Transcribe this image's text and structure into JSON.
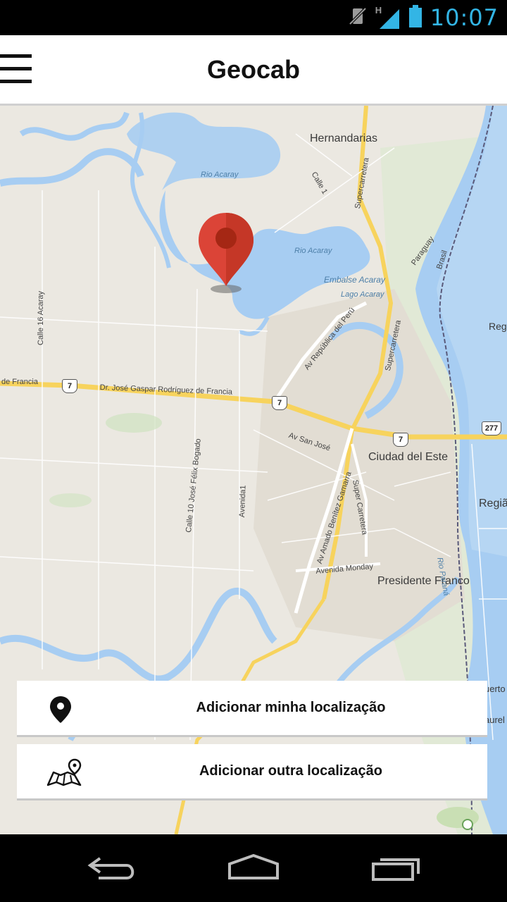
{
  "status_bar": {
    "time": "10:07",
    "network_label": "H",
    "icons": [
      "mute-vibrate-icon",
      "signal-icon",
      "battery-icon"
    ],
    "accent_color": "#33b5e5"
  },
  "app_bar": {
    "title": "Geocab",
    "menu_icon": "hamburger-menu-icon"
  },
  "map": {
    "cities": {
      "hernandarias": "Hernandarias",
      "ciudad_del_este": "Ciudad del Este",
      "presidente_franco": "Presidente Franco",
      "regi": "Regi",
      "regia": "Regiã",
      "puerto": "uerto",
      "iguazu": "aurel"
    },
    "water": {
      "rio_acaray_1": "Rio Acaray",
      "rio_acaray_2": "Rio Acaray",
      "embalse": "Embalse Acaray",
      "lago": "Lago Acaray",
      "rio_parana": "Rio Paraná"
    },
    "roads": {
      "calle_16": "Calle 16 Acaray",
      "calle_1": "Calle 1",
      "supercarretera_1": "Supercarretera",
      "supercarretera_2": "Supercarretera",
      "super_carretera": "Super Carretera",
      "av_republica": "Av República del Perú",
      "francia_left": "de Francia",
      "francia_main": "Dr. José Gaspar Rodríguez de Francia",
      "av_san_jose": "Av San José",
      "calle_10": "Calle 10 José Félix Bogado",
      "avenida_1": "Avenida1",
      "av_amado": "Av Amado Benítez Gamarra",
      "avenida_monday": "Avenida Monday",
      "paraguay": "Paraguay",
      "brasil": "Brasil"
    },
    "route_shields": {
      "r7_a": "7",
      "r7_b": "7",
      "r7_c": "7",
      "r277": "277"
    },
    "marker_color": "#db4437",
    "water_color": "#a7cdf2",
    "highway_color": "#f7d35d"
  },
  "actions": [
    {
      "label": "Adicionar minha localização",
      "icon": "location-pin-icon"
    },
    {
      "label": "Adicionar outra localização",
      "icon": "folded-map-pin-icon"
    }
  ],
  "nav_bar": {
    "buttons": [
      "back-icon",
      "home-icon",
      "recent-apps-icon"
    ]
  }
}
